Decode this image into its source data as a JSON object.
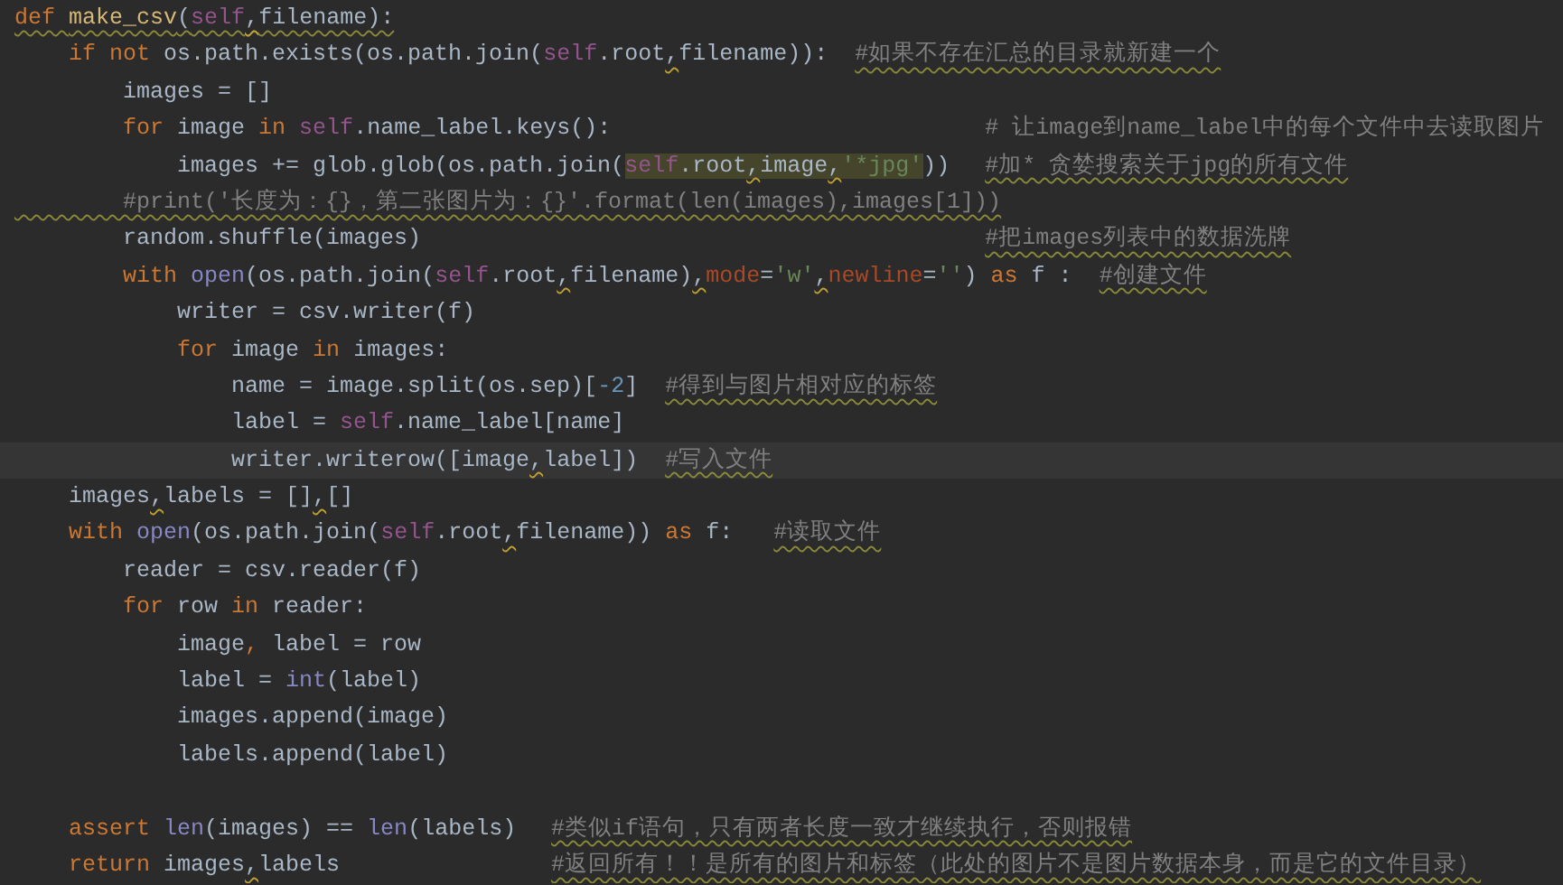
{
  "editor": {
    "lines": [
      {
        "kind": "normal",
        "warn": true,
        "code": [
          {
            "kind": "keyword",
            "s": "def "
          },
          {
            "kind": "function",
            "s": "make_csv"
          },
          {
            "kind": "plain",
            "s": "("
          },
          {
            "kind": "self",
            "s": "self"
          },
          {
            "kind": "comma",
            "s": ","
          },
          {
            "kind": "plain",
            "s": "filename):"
          }
        ]
      },
      {
        "kind": "normal",
        "code": [
          {
            "kind": "keyword",
            "s": "    if not "
          },
          {
            "kind": "plain",
            "s": "os.path.exists(os.path.join("
          },
          {
            "kind": "self",
            "s": "self"
          },
          {
            "kind": "plain",
            "s": ".root"
          },
          {
            "kind": "comma",
            "s": ","
          },
          {
            "kind": "plain",
            "s": "filename)):"
          }
        ],
        "comment": {
          "text": "#如果不存在汇总的目录就新建一个",
          "kind": "inline",
          "typo": true
        }
      },
      {
        "kind": "normal",
        "code": [
          {
            "kind": "plain",
            "s": "        images = []"
          }
        ]
      },
      {
        "kind": "normal",
        "code": [
          {
            "kind": "keyword",
            "s": "        for "
          },
          {
            "kind": "plain",
            "s": "image "
          },
          {
            "kind": "keyword",
            "s": "in "
          },
          {
            "kind": "self",
            "s": "self"
          },
          {
            "kind": "plain",
            "s": ".name_label.keys():"
          }
        ],
        "comment": {
          "text": "# 让image到name_label中的每个文件中去读取图片",
          "kind": "far",
          "typo": false
        }
      },
      {
        "kind": "normal",
        "code": [
          {
            "kind": "plain",
            "s": "            images += glob.glob(os.path.join("
          },
          {
            "kind": "match",
            "parts": [
              {
                "kind": "self",
                "s": "self"
              },
              {
                "kind": "plain",
                "s": ".root"
              },
              {
                "kind": "comma",
                "s": ","
              },
              {
                "kind": "plain",
                "s": "image"
              },
              {
                "kind": "comma",
                "s": ","
              },
              {
                "kind": "string",
                "s": "'*jpg'"
              }
            ]
          },
          {
            "kind": "plain",
            "s": "))"
          }
        ],
        "comment": {
          "text": "#加* 贪婪搜索关于jpg的所有文件",
          "kind": "far",
          "typo": true
        }
      },
      {
        "kind": "normal",
        "comment": {
          "text": "        #print('长度为：{}，第二张图片为：{}'.format(len(images),images[1]))",
          "kind": "inline",
          "typo": true
        }
      },
      {
        "kind": "normal",
        "code": [
          {
            "kind": "plain",
            "s": "        random.shuffle(images)"
          }
        ],
        "comment": {
          "text": "#把images列表中的数据洗牌",
          "kind": "far",
          "typo": true
        }
      },
      {
        "kind": "normal",
        "code": [
          {
            "kind": "keyword",
            "s": "        with "
          },
          {
            "kind": "builtin",
            "s": "open"
          },
          {
            "kind": "plain",
            "s": "(os.path.join("
          },
          {
            "kind": "self",
            "s": "self"
          },
          {
            "kind": "plain",
            "s": ".root"
          },
          {
            "kind": "comma",
            "s": ","
          },
          {
            "kind": "plain",
            "s": "filename)"
          },
          {
            "kind": "comma",
            "s": ","
          },
          {
            "kind": "param",
            "s": "mode"
          },
          {
            "kind": "plain",
            "s": "="
          },
          {
            "kind": "string",
            "s": "'w'"
          },
          {
            "kind": "comma",
            "s": ","
          },
          {
            "kind": "param",
            "s": "newline"
          },
          {
            "kind": "plain",
            "s": "="
          },
          {
            "kind": "string",
            "s": "''"
          },
          {
            "kind": "plain",
            "s": ") "
          },
          {
            "kind": "keyword",
            "s": "as "
          },
          {
            "kind": "plain",
            "s": "f :"
          }
        ],
        "comment": {
          "text": "#创建文件",
          "kind": "inline",
          "typo": true
        }
      },
      {
        "kind": "normal",
        "code": [
          {
            "kind": "plain",
            "s": "            writer = csv.writer(f)"
          }
        ]
      },
      {
        "kind": "normal",
        "code": [
          {
            "kind": "keyword",
            "s": "            for "
          },
          {
            "kind": "plain",
            "s": "image "
          },
          {
            "kind": "keyword",
            "s": "in "
          },
          {
            "kind": "plain",
            "s": "images:"
          }
        ]
      },
      {
        "kind": "normal",
        "code": [
          {
            "kind": "plain",
            "s": "                name = image.split(os.sep)["
          },
          {
            "kind": "number",
            "s": "-2"
          },
          {
            "kind": "plain",
            "s": "]"
          }
        ],
        "comment": {
          "text": "#得到与图片相对应的标签",
          "kind": "inline",
          "typo": true
        }
      },
      {
        "kind": "normal",
        "code": [
          {
            "kind": "plain",
            "s": "                label = "
          },
          {
            "kind": "self",
            "s": "self"
          },
          {
            "kind": "plain",
            "s": ".name_label[name]"
          }
        ]
      },
      {
        "kind": "caret",
        "code": [
          {
            "kind": "plain",
            "s": "                writer.writerow([image"
          },
          {
            "kind": "comma",
            "s": ","
          },
          {
            "kind": "plain",
            "s": "label])"
          }
        ],
        "comment": {
          "text": "#写入文件",
          "kind": "inline",
          "typo": true
        }
      },
      {
        "kind": "normal",
        "code": [
          {
            "kind": "plain",
            "s": "    images"
          },
          {
            "kind": "comma",
            "s": ","
          },
          {
            "kind": "plain",
            "s": "labels = []"
          },
          {
            "kind": "comma",
            "s": ","
          },
          {
            "kind": "plain",
            "s": "[]"
          }
        ]
      },
      {
        "kind": "normal",
        "code": [
          {
            "kind": "keyword",
            "s": "    with "
          },
          {
            "kind": "builtin",
            "s": "open"
          },
          {
            "kind": "plain",
            "s": "(os.path.join("
          },
          {
            "kind": "self",
            "s": "self"
          },
          {
            "kind": "plain",
            "s": ".root"
          },
          {
            "kind": "comma",
            "s": ","
          },
          {
            "kind": "plain",
            "s": "filename)) "
          },
          {
            "kind": "keyword",
            "s": "as "
          },
          {
            "kind": "plain",
            "s": "f:"
          }
        ],
        "comment": {
          "text": "#读取文件",
          "kind": "wide",
          "typo": true
        }
      },
      {
        "kind": "normal",
        "code": [
          {
            "kind": "plain",
            "s": "        reader = csv.reader(f)"
          }
        ]
      },
      {
        "kind": "normal",
        "code": [
          {
            "kind": "keyword",
            "s": "        for "
          },
          {
            "kind": "plain",
            "s": "row "
          },
          {
            "kind": "keyword",
            "s": "in "
          },
          {
            "kind": "plain",
            "s": "reader:"
          }
        ]
      },
      {
        "kind": "normal",
        "code": [
          {
            "kind": "plain",
            "s": "            image"
          },
          {
            "kind": "keyword",
            "s": ","
          },
          {
            "kind": "plain",
            "s": " label = row"
          }
        ]
      },
      {
        "kind": "normal",
        "code": [
          {
            "kind": "plain",
            "s": "            label = "
          },
          {
            "kind": "builtin",
            "s": "int"
          },
          {
            "kind": "plain",
            "s": "(label)"
          }
        ]
      },
      {
        "kind": "normal",
        "code": [
          {
            "kind": "plain",
            "s": "            images.append(image)"
          }
        ]
      },
      {
        "kind": "normal",
        "code": [
          {
            "kind": "plain",
            "s": "            labels.append(label)"
          }
        ]
      },
      {
        "kind": "normal"
      },
      {
        "kind": "normal",
        "code": [
          {
            "kind": "keyword",
            "s": "    assert "
          },
          {
            "kind": "builtin",
            "s": "len"
          },
          {
            "kind": "plain",
            "s": "(images) == "
          },
          {
            "kind": "builtin",
            "s": "len"
          },
          {
            "kind": "plain",
            "s": "(labels)"
          }
        ],
        "comment": {
          "text": "#类似if语句，只有两者长度一致才继续执行，否则报错",
          "kind": "mid",
          "typo": true
        }
      },
      {
        "kind": "normal",
        "code": [
          {
            "kind": "keyword",
            "s": "    return "
          },
          {
            "kind": "plain",
            "s": "images"
          },
          {
            "kind": "comma",
            "s": ","
          },
          {
            "kind": "plain",
            "s": "labels"
          }
        ],
        "comment": {
          "text": "#返回所有！！是所有的图片和标签（此处的图片不是图片数据本身，而是它的文件目录）",
          "kind": "mid",
          "typo": true
        }
      }
    ]
  }
}
